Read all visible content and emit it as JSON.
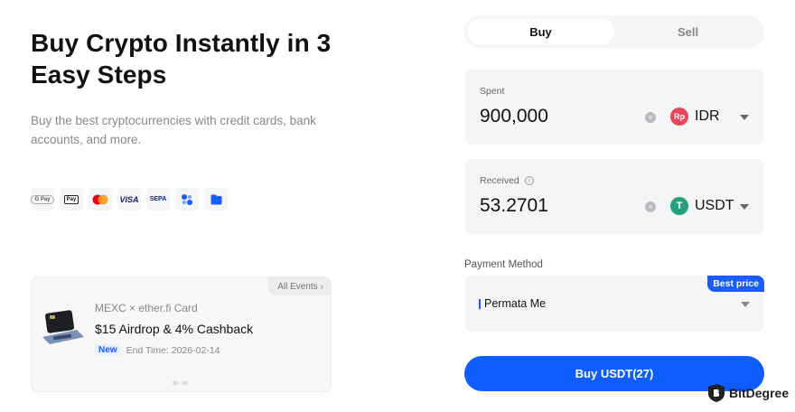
{
  "hero": {
    "title": "Buy Crypto Instantly in 3 Easy Steps",
    "subtitle": "Buy the best cryptocurrencies with credit cards, bank accounts, and more."
  },
  "payment_icons": [
    {
      "name": "google-pay-icon",
      "label": "G Pay"
    },
    {
      "name": "apple-pay-icon",
      "label": "Pay"
    },
    {
      "name": "mastercard-icon",
      "label": ""
    },
    {
      "name": "visa-icon",
      "label": "VISA"
    },
    {
      "name": "sepa-icon",
      "label": "SEPA"
    },
    {
      "name": "circle-dots-icon",
      "label": ""
    },
    {
      "name": "wallet-card-icon",
      "label": ""
    }
  ],
  "event": {
    "all_events": "All Events",
    "line1": "MEXC × ether.fi Card",
    "line2": "$15 Airdrop & 4% Cashback",
    "badge": "New",
    "end_time": "End Time: 2026-02-14"
  },
  "tabs": {
    "buy": "Buy",
    "sell": "Sell",
    "active": "buy"
  },
  "spent": {
    "label": "Spent",
    "value": "900,000",
    "currency": "IDR",
    "currency_icon_text": "Rp",
    "icon_color": "#e8465a"
  },
  "received": {
    "label": "Received",
    "value": "53.2701",
    "currency": "USDT",
    "currency_icon_text": "T",
    "icon_color": "#26a17b"
  },
  "payment_method": {
    "label": "Payment Method",
    "badge": "Best price",
    "name": "Permata Me"
  },
  "buy_button": {
    "label": "Buy USDT(27)"
  },
  "colors": {
    "accent": "#0f5cff"
  },
  "watermark": {
    "text": "BitDegree"
  }
}
